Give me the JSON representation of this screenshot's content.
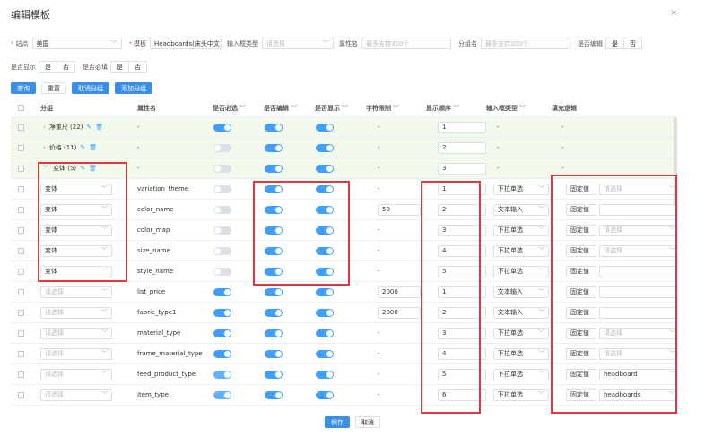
{
  "dialog": {
    "title": "编辑模板",
    "close": "×"
  },
  "filters": {
    "site_label": "站点",
    "site_value": "美国",
    "template_label": "模板",
    "template_value": "Headboards(床头中文",
    "input_type_label": "输入框类型",
    "input_type_placeholder": "请选择",
    "attr_name_label": "属性名",
    "attr_name_placeholder": "最多支持300个",
    "group_name_label": "分组名",
    "group_name_placeholder": "最多支持300个",
    "editable_label": "是否编辑",
    "yes": "是",
    "no": "否",
    "display_label": "是否显示",
    "required_label": "是否必填"
  },
  "buttons": {
    "query": "查询",
    "reset": "重置",
    "cancel_group": "取消分组",
    "add_group": "添加分组",
    "save": "保存",
    "cancel": "取消"
  },
  "headers": [
    "分组",
    "属性名",
    "是否必选",
    "是否编辑",
    "是否显示",
    "字符限制",
    "显示顺序",
    "输入框类型",
    "填充逻辑"
  ],
  "groups": [
    {
      "name": "净重尺 (22)",
      "attr": "-",
      "required": true,
      "edit": true,
      "show": true,
      "limit": "-",
      "order": "1",
      "input": "-",
      "fill": "-"
    },
    {
      "name": "价格 (11)",
      "attr": "-",
      "required": false,
      "edit": true,
      "show": true,
      "limit": "-",
      "order": "2",
      "input": "-",
      "fill": "-"
    },
    {
      "name": "变体 (5)",
      "attr": "-",
      "required": false,
      "edit": true,
      "show": true,
      "limit": "-",
      "order": "3",
      "input": "-",
      "fill": "-"
    }
  ],
  "placeholder": "请选择",
  "rows": [
    {
      "group": "变体",
      "attr": "variation_theme",
      "required": false,
      "edit": true,
      "show": true,
      "limit": "-",
      "order": "1",
      "input": "下拉单选",
      "fill_type": "固定值",
      "fill_value": "请选择",
      "fill_kind": "select"
    },
    {
      "group": "变体",
      "attr": "color_name",
      "required": false,
      "edit": true,
      "show": true,
      "limit": "50",
      "order": "2",
      "input": "文本输入",
      "fill_type": "固定值",
      "fill_value": "",
      "fill_kind": "input"
    },
    {
      "group": "变体",
      "attr": "color_map",
      "required": false,
      "edit": true,
      "show": true,
      "limit": "-",
      "order": "3",
      "input": "下拉单选",
      "fill_type": "固定值",
      "fill_value": "请选择",
      "fill_kind": "select"
    },
    {
      "group": "变体",
      "attr": "size_name",
      "required": false,
      "edit": true,
      "show": true,
      "limit": "-",
      "order": "4",
      "input": "下拉单选",
      "fill_type": "固定值",
      "fill_value": "请选择",
      "fill_kind": "select"
    },
    {
      "group": "变体",
      "attr": "style_name",
      "required": false,
      "edit": true,
      "show": true,
      "limit": "-",
      "order": "5",
      "input": "下拉单选",
      "fill_type": "固定值",
      "fill_value": "",
      "fill_kind": "input"
    },
    {
      "group": "",
      "attr": "list_price",
      "required": true,
      "edit": true,
      "show": true,
      "limit": "2000",
      "order": "1",
      "input": "文本输入",
      "fill_type": "固定值",
      "fill_value": "",
      "fill_kind": "input"
    },
    {
      "group": "",
      "attr": "fabric_type1",
      "required": true,
      "edit": true,
      "show": true,
      "limit": "2000",
      "order": "2",
      "input": "文本输入",
      "fill_type": "固定值",
      "fill_value": "",
      "fill_kind": "input"
    },
    {
      "group": "",
      "attr": "material_type",
      "required": true,
      "edit": true,
      "show": true,
      "limit": "-",
      "order": "3",
      "input": "下拉单选",
      "fill_type": "固定值",
      "fill_value": "请选择",
      "fill_kind": "select"
    },
    {
      "group": "",
      "attr": "frame_material_type",
      "required": true,
      "edit": true,
      "show": true,
      "limit": "-",
      "order": "4",
      "input": "下拉单选",
      "fill_type": "固定值",
      "fill_value": "请选择",
      "fill_kind": "select"
    },
    {
      "group": "",
      "attr": "feed_product_type",
      "required": true,
      "edit": true,
      "show": true,
      "limit": "-",
      "order": "5",
      "input": "下拉单选",
      "fill_type": "固定值",
      "fill_value": "headboard",
      "fill_kind": "select"
    },
    {
      "group": "",
      "attr": "item_type",
      "required": true,
      "edit": true,
      "show": true,
      "limit": "-",
      "order": "6",
      "input": "下拉单选",
      "fill_type": "固定值",
      "fill_value": "headboards",
      "fill_kind": "select"
    }
  ]
}
